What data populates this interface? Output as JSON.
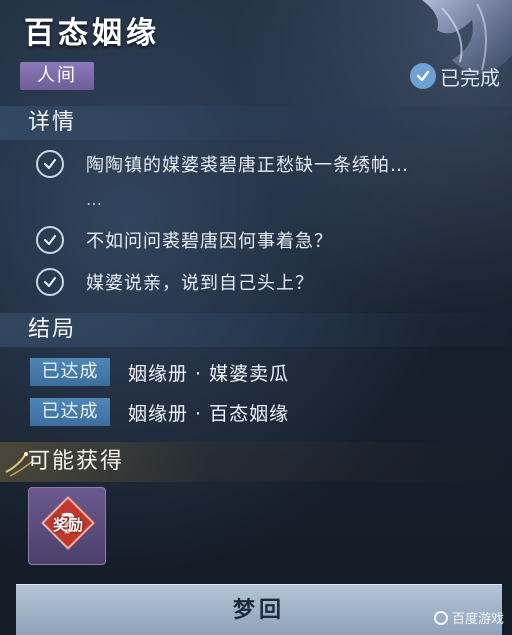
{
  "quest": {
    "title": "百态姻缘",
    "realm": "人间",
    "status": "已完成"
  },
  "details": {
    "title": "详情",
    "tasks": [
      "陶陶镇的媒婆裘碧唐正愁缺一条绣帕…",
      "不如问问裘碧唐因何事着急？",
      "媒婆说亲，说到自己头上？"
    ],
    "ellipsis": "…"
  },
  "endings": {
    "title": "结局",
    "items": [
      {
        "badge": "已达成",
        "name": "姻缘册 · 媒婆卖瓜"
      },
      {
        "badge": "已达成",
        "name": "姻缘册 · 百态姻缘"
      }
    ]
  },
  "rewards": {
    "title": "可能获得",
    "item_label": "奖励"
  },
  "actions": {
    "revisit_label": "梦回"
  },
  "watermark": {
    "text": "百度游戏"
  },
  "colors": {
    "realm_tag": "#7c6aa9",
    "badge": "#4679a9",
    "status_check": "#6ea2d6"
  },
  "icons": {
    "status": "check-circle-icon",
    "task": "check-circle-icon",
    "reward": "question-mark-icon"
  }
}
